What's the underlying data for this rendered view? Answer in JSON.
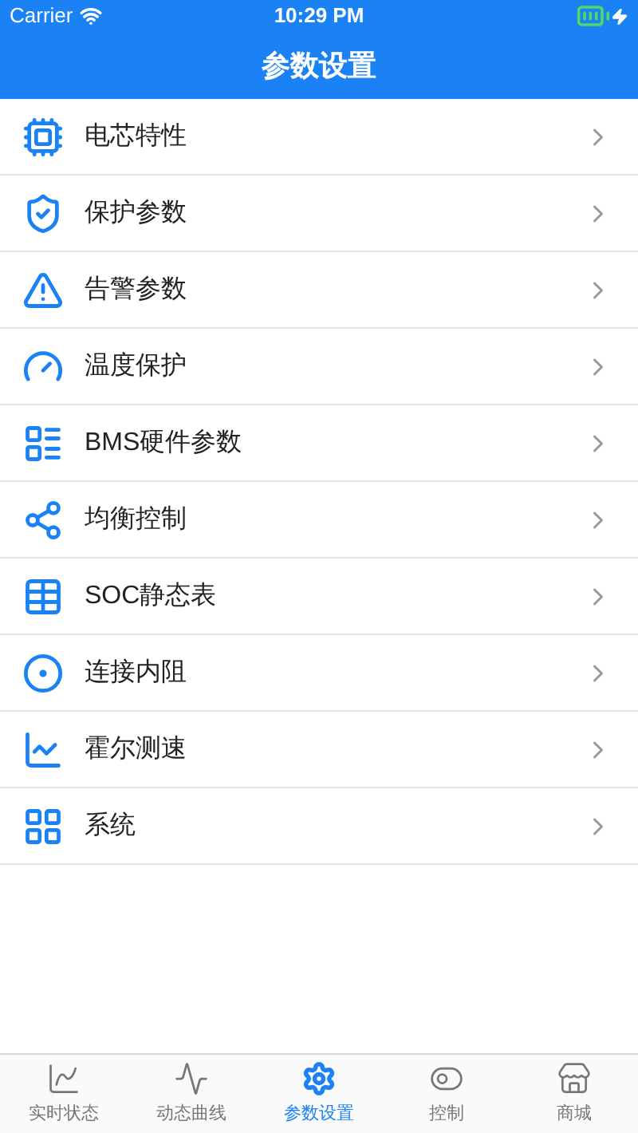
{
  "status_bar": {
    "carrier": "Carrier",
    "time": "10:29 PM"
  },
  "nav_bar": {
    "title": "参数设置"
  },
  "menu": [
    {
      "label": "电芯特性"
    },
    {
      "label": "保护参数"
    },
    {
      "label": "告警参数"
    },
    {
      "label": "温度保护"
    },
    {
      "label": "BMS硬件参数"
    },
    {
      "label": "均衡控制"
    },
    {
      "label": "SOC静态表"
    },
    {
      "label": "连接内阻"
    },
    {
      "label": "霍尔测速"
    },
    {
      "label": "系统"
    }
  ],
  "tab_bar": [
    {
      "label": "实时状态",
      "selected": false
    },
    {
      "label": "动态曲线",
      "selected": false
    },
    {
      "label": "参数设置",
      "selected": true
    },
    {
      "label": "控制",
      "selected": false
    },
    {
      "label": "商城",
      "selected": false
    }
  ]
}
